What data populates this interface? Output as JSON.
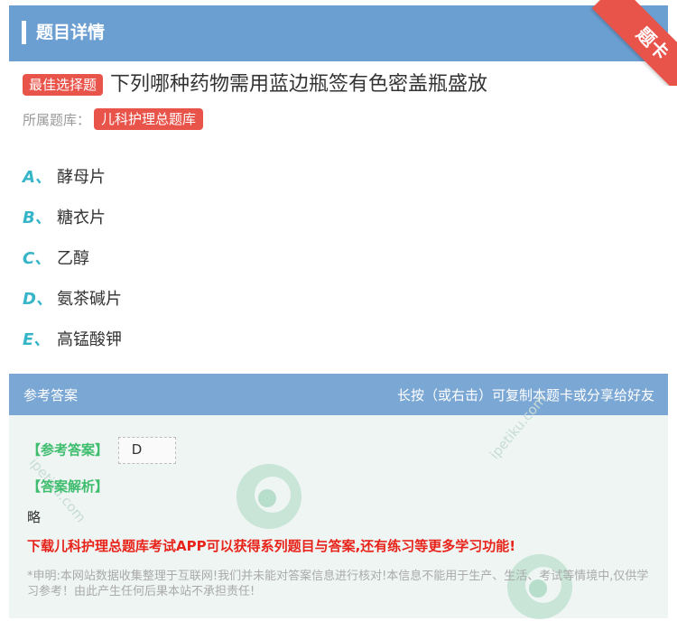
{
  "header": {
    "title": "题目详情"
  },
  "ribbon": {
    "text": "题卡"
  },
  "question": {
    "type_tag": "最佳选择题",
    "text": "下列哪种药物需用蓝边瓶签有色密盖瓶盛放",
    "source_label": "所属题库：",
    "source_tag": "儿科护理总题库"
  },
  "options": [
    {
      "letter": "A、",
      "text": "酵母片"
    },
    {
      "letter": "B、",
      "text": "糖衣片"
    },
    {
      "letter": "C、",
      "text": "乙醇"
    },
    {
      "letter": "D、",
      "text": "氨茶碱片"
    },
    {
      "letter": "E、",
      "text": "高锰酸钾"
    }
  ],
  "answer": {
    "head_left": "参考答案",
    "head_right": "长按（或右击）可复制本题卡或分享给好友",
    "answer_label": "【参考答案】",
    "answer_value": "D",
    "analysis_label": "【答案解析】",
    "analysis_text": "略",
    "promo": "下载儿科护理总题库考试APP可以获得系列题目与答案,还有练习等更多学习功能!",
    "disclaimer": "*申明:本网站数据收集整理于互联网!我们并未能对答案信息进行核对!本信息不能用于生产、生活、考试等情境中,仅供学习参考！由此产生任何后果本站不承担责任!"
  },
  "watermark": {
    "text": "ipetiku.com"
  },
  "colors": {
    "header": "#6b9fd1",
    "accent_red": "#e8534a",
    "option_letter": "#37b5c8",
    "answer_green": "#3dbd6d"
  }
}
